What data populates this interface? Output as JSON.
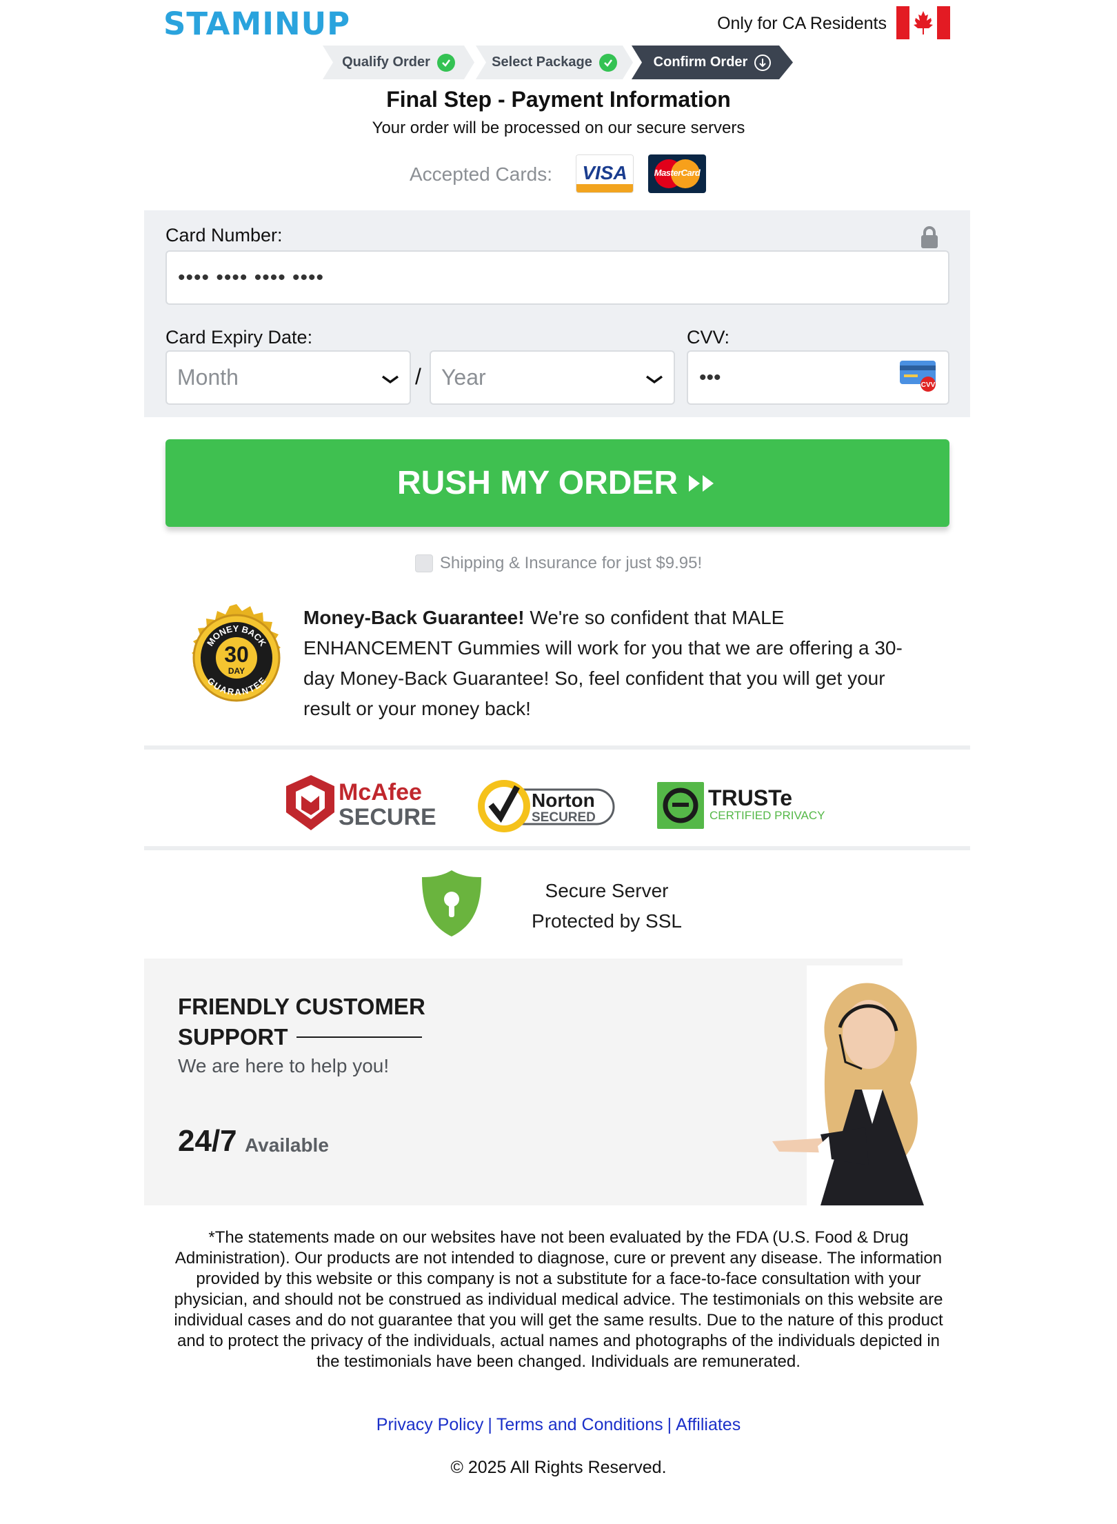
{
  "header": {
    "logo": "STAMINUP",
    "residency": "Only for CA Residents"
  },
  "steps": [
    {
      "label": "Qualify Order",
      "state": "done"
    },
    {
      "label": "Select Package",
      "state": "done"
    },
    {
      "label": "Confirm Order",
      "state": "active"
    }
  ],
  "payment": {
    "title": "Final Step - Payment Information",
    "subtitle": "Your order will be processed on our secure servers",
    "accepted_label": "Accepted Cards:",
    "cards": [
      "VISA",
      "MasterCard"
    ]
  },
  "form": {
    "card_number_label": "Card Number:",
    "card_number_value": "•••• •••• •••• ••••",
    "expiry_label": "Card Expiry Date:",
    "month_placeholder": "Month",
    "year_placeholder": "Year",
    "slash": "/",
    "cvv_label": "CVV:",
    "cvv_value": "•••",
    "cvv_badge": "CVV"
  },
  "cta": {
    "label": "RUSH MY ORDER",
    "shipping_text": "Shipping & Insurance for just $9.95!"
  },
  "guarantee": {
    "seal_top": "MONEY BACK",
    "seal_number": "30",
    "seal_day": "DAY",
    "seal_bottom": "GUARANTEE",
    "bold": "Money-Back Guarantee!",
    "text": " We're so confident that MALE ENHANCEMENT Gummies will work for you that we are offering a 30-day Money-Back Guarantee! So, feel confident that you will get your result or your money back!"
  },
  "trust_badges": {
    "mcafee_line1": "McAfee",
    "mcafee_line2": "SECURE",
    "norton_line1": "Norton",
    "norton_line2": "SECURED",
    "truste_line1": "TRUSTe",
    "truste_line2": "CERTIFIED PRIVACY"
  },
  "ssl": {
    "line1": "Secure Server",
    "line2": "Protected by SSL"
  },
  "support": {
    "title_line1": "FRIENDLY CUSTOMER",
    "title_line2": "SUPPORT",
    "subtitle": "We are here to help you!",
    "hours": "24/7",
    "available": "Available"
  },
  "footer": {
    "disclaimer": "*The statements made on our websites have not been evaluated by the FDA (U.S. Food & Drug Administration). Our products are not intended to diagnose, cure or prevent any disease. The information provided by this website or this company is not a substitute for a face-to-face consultation with your physician, and should not be construed as individual medical advice. The testimonials on this website are individual cases and do not guarantee that you will get the same results. Due to the nature of this product and to protect the privacy of the individuals, actual names and photographs of the individuals depicted in the testimonials have been changed. Individuals are remunerated.",
    "links": [
      "Privacy Policy",
      "Terms and Conditions",
      "Affiliates"
    ],
    "separator": "|",
    "copyright": "© 2025 All Rights Reserved."
  },
  "colors": {
    "brand": "#2aa3dd",
    "cta_green": "#3fc050",
    "check_green": "#34c253",
    "step_active": "#3b4350",
    "link_blue": "#1b30c9"
  }
}
